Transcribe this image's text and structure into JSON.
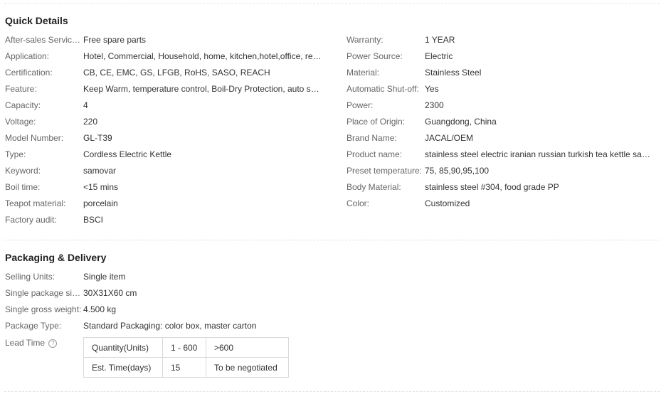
{
  "quick_details": {
    "title": "Quick Details",
    "left": [
      {
        "label": "After-sales Service Provided:",
        "value": "Free spare parts"
      },
      {
        "label": "Application:",
        "value": "Hotel, Commercial, Household, home, kitchen,hotel,office, restaurant"
      },
      {
        "label": "Certification:",
        "value": "CB, CE, EMC, GS, LFGB, RoHS, SASO, REACH"
      },
      {
        "label": "Feature:",
        "value": "Keep Warm, temperature control, Boil-Dry Protection, auto shut-off"
      },
      {
        "label": "Capacity:",
        "value": "4"
      },
      {
        "label": "Voltage:",
        "value": "220"
      },
      {
        "label": "Model Number:",
        "value": "GL-T39"
      },
      {
        "label": "Type:",
        "value": "Cordless Electric Kettle"
      },
      {
        "label": "Keyword:",
        "value": "samovar"
      },
      {
        "label": "Boil time:",
        "value": "<15 mins"
      },
      {
        "label": "Teapot material:",
        "value": "porcelain"
      },
      {
        "label": "Factory audit:",
        "value": "BSCI"
      }
    ],
    "right": [
      {
        "label": "Warranty:",
        "value": "1 YEAR"
      },
      {
        "label": "Power Source:",
        "value": "Electric"
      },
      {
        "label": "Material:",
        "value": "Stainless Steel"
      },
      {
        "label": "Automatic Shut-off:",
        "value": "Yes"
      },
      {
        "label": "Power:",
        "value": "2300"
      },
      {
        "label": "Place of Origin:",
        "value": "Guangdong, China"
      },
      {
        "label": "Brand Name:",
        "value": "JACAL/OEM"
      },
      {
        "label": "Product name:",
        "value": "stainless steel electric iranian russian turkish tea kettle samovar"
      },
      {
        "label": "Preset temperature:",
        "value": "75, 85,90,95,100"
      },
      {
        "label": "Body Material:",
        "value": "stainless steel #304, food grade PP"
      },
      {
        "label": "Color:",
        "value": "Customized"
      }
    ]
  },
  "packaging": {
    "title": "Packaging & Delivery",
    "rows": [
      {
        "label": "Selling Units:",
        "value": "Single item"
      },
      {
        "label": "Single package size:",
        "value": "30X31X60 cm"
      },
      {
        "label": "Single gross weight:",
        "value": "4.500 kg"
      },
      {
        "label": "Package Type:",
        "value": "Standard Packaging: color box, master carton"
      }
    ],
    "lead_time": {
      "label": "Lead Time",
      "help_glyph": "?",
      "table": {
        "header": [
          "Quantity(Units)",
          "1 - 600",
          ">600"
        ],
        "row": [
          "Est. Time(days)",
          "15",
          "To be negotiated"
        ]
      }
    }
  }
}
